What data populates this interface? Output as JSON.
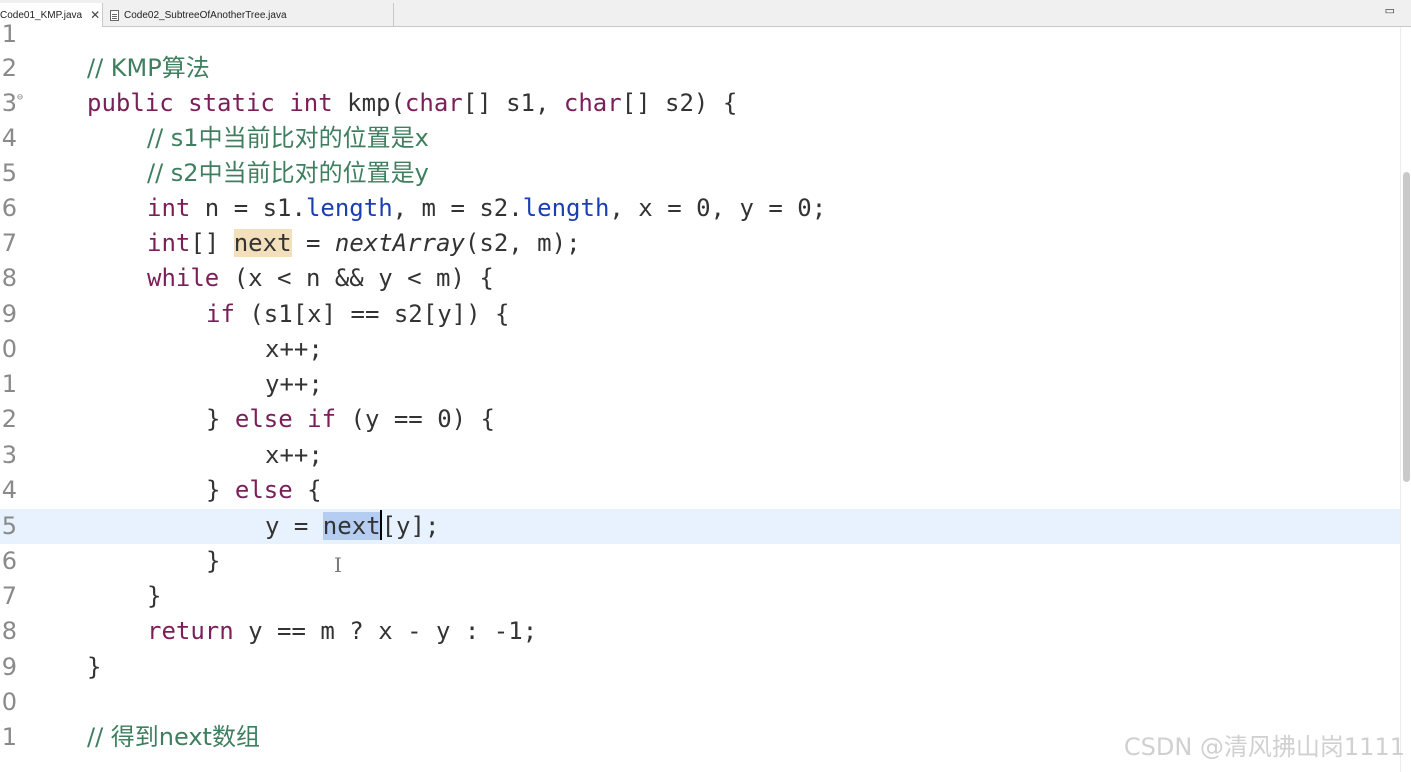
{
  "tabs": [
    {
      "label": "Code01_KMP.java",
      "active": true
    },
    {
      "label": "Code02_SubtreeOfAnotherTree.java",
      "active": false
    }
  ],
  "watermark": "CSDN @清风拂山岗1111",
  "line_numbers": [
    "1",
    "2",
    "3",
    "4",
    "5",
    "6",
    "7",
    "8",
    "9",
    "0",
    "1",
    "2",
    "3",
    "4",
    "5",
    "6",
    "7",
    "8",
    "9",
    "0",
    "1"
  ],
  "code": {
    "l2": "// KMP算法",
    "l3": {
      "k1": "public",
      "k2": "static",
      "k3": "int",
      "rest": " kmp(",
      "k4": "char",
      "mid": "[] s1, ",
      "k5": "char",
      "end": "[] s2) {"
    },
    "l4": "// s1中当前比对的位置是x",
    "l5": "// s2中当前比对的位置是y",
    "l6": {
      "k": "int",
      "a": " n = s1.",
      "f1": "length",
      "b": ", m = s2.",
      "f2": "length",
      "c": ", x = 0, y = 0;"
    },
    "l7": {
      "k": "int",
      "a": "[] ",
      "occ": "next",
      "b": " = ",
      "it": "nextArray",
      "c": "(s2, m);"
    },
    "l8": {
      "k": "while",
      "a": " (x < n && y < m) {"
    },
    "l9": {
      "k": "if",
      "a": " (s1[x] == s2[y]) {"
    },
    "l10": "x++;",
    "l11": "y++;",
    "l12": {
      "a": "} ",
      "k1": "else",
      "b": " ",
      "k2": "if",
      "c": " (y == 0) {"
    },
    "l13": "x++;",
    "l14": {
      "a": "} ",
      "k": "else",
      "b": " {"
    },
    "l15": {
      "a": "y = ",
      "sel": "next",
      "b": "[y];"
    },
    "l16": "}",
    "l17": "}",
    "l18": {
      "k": "return",
      "a": " y == m ? x - y : -1;"
    },
    "l19": "}",
    "l21": "// 得到next数组"
  }
}
